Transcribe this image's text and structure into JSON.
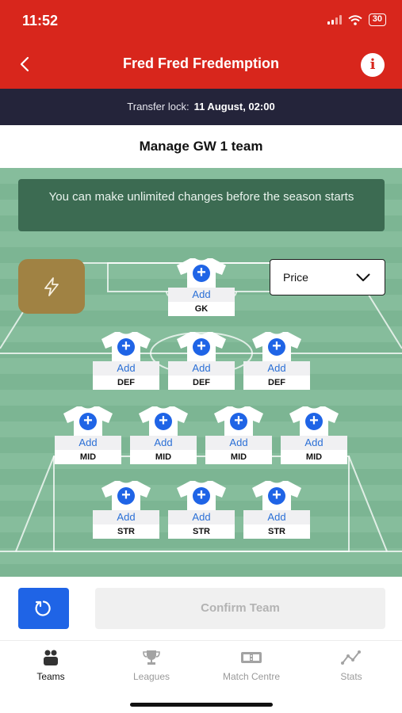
{
  "status": {
    "time": "11:52",
    "battery": "30"
  },
  "header": {
    "title": "Fred Fred Fredemption"
  },
  "transfer_lock": {
    "label": "Transfer lock:",
    "value": "11 August, 02:00"
  },
  "manage": {
    "title": "Manage GW 1 team"
  },
  "notice": {
    "text": "You can make unlimited changes before the season starts"
  },
  "sort": {
    "selected": "Price"
  },
  "slots": [
    {
      "add": "Add",
      "position": "GK"
    },
    {
      "add": "Add",
      "position": "DEF"
    },
    {
      "add": "Add",
      "position": "DEF"
    },
    {
      "add": "Add",
      "position": "DEF"
    },
    {
      "add": "Add",
      "position": "MID"
    },
    {
      "add": "Add",
      "position": "MID"
    },
    {
      "add": "Add",
      "position": "MID"
    },
    {
      "add": "Add",
      "position": "MID"
    },
    {
      "add": "Add",
      "position": "STR"
    },
    {
      "add": "Add",
      "position": "STR"
    },
    {
      "add": "Add",
      "position": "STR"
    }
  ],
  "actions": {
    "confirm": "Confirm Team"
  },
  "tabs": [
    {
      "label": "Teams",
      "icon": "teams-icon",
      "active": true
    },
    {
      "label": "Leagues",
      "icon": "trophy-icon",
      "active": false
    },
    {
      "label": "Match Centre",
      "icon": "scoreboard-icon",
      "active": false
    },
    {
      "label": "Stats",
      "icon": "stats-icon",
      "active": false
    }
  ],
  "colors": {
    "brand_red": "#d8261c",
    "lock_bar": "#24243a",
    "pitch_green": "#86bd9c",
    "notice_green": "#3c6b52",
    "add_blue": "#1f64e6",
    "boost_gold": "#a08243"
  }
}
